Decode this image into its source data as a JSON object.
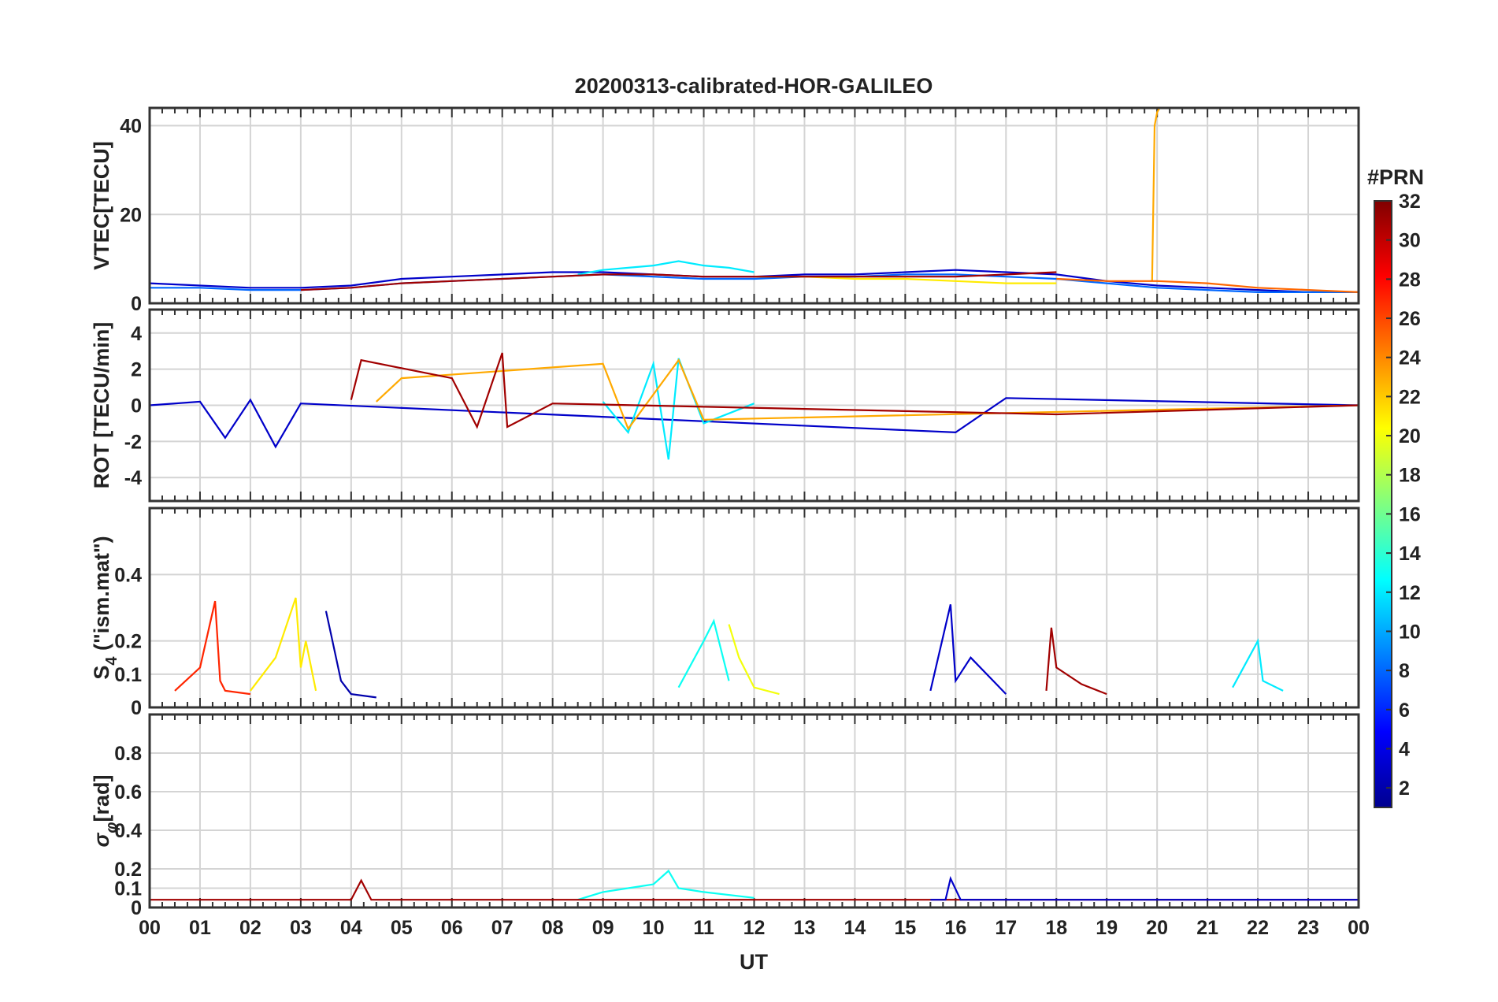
{
  "chart_data": {
    "type": "line",
    "title": "20200313-calibrated-HOR-GALILEO",
    "xlabel": "UT",
    "x_tick_labels": [
      "00",
      "01",
      "02",
      "03",
      "04",
      "05",
      "06",
      "07",
      "08",
      "09",
      "10",
      "11",
      "12",
      "13",
      "14",
      "15",
      "16",
      "17",
      "18",
      "19",
      "20",
      "21",
      "22",
      "23",
      "00"
    ],
    "xlim_hours": [
      0,
      24
    ],
    "grid": true,
    "panels": [
      {
        "id": "vtec",
        "ylabel_main": "VTEC[TECU]",
        "ylabel_sub": "",
        "ylabel_tail": "",
        "ylim": [
          0,
          44
        ],
        "yticks": [
          0,
          20,
          40
        ],
        "series": [
          {
            "prn": 3,
            "x": [
              0,
              1,
              2,
              3,
              4,
              5,
              6,
              7,
              8,
              9,
              10,
              11,
              12,
              13,
              14,
              15,
              16,
              17,
              18,
              19,
              20,
              21,
              22,
              23,
              24
            ],
            "y": [
              4.5,
              4,
              3.5,
              3.5,
              4,
              5.5,
              6,
              6.5,
              7,
              7,
              6.5,
              6,
              6,
              6.5,
              6.5,
              7,
              7.5,
              7,
              6.5,
              5,
              4,
              3.5,
              3,
              2.5,
              2.5
            ]
          },
          {
            "prn": 8,
            "x": [
              0,
              1,
              2,
              3,
              4,
              5,
              6,
              7,
              8,
              9,
              10,
              11,
              12,
              13,
              14,
              15,
              16,
              17,
              18,
              19,
              20,
              21,
              22,
              23,
              24
            ],
            "y": [
              3.5,
              3.5,
              3,
              3,
              3.5,
              4.5,
              5,
              5.5,
              6,
              6.5,
              6,
              5.5,
              5.5,
              6,
              6,
              6.5,
              6.5,
              6,
              5.5,
              4.5,
              3.5,
              3,
              2.5,
              2.5,
              2.5
            ]
          },
          {
            "prn": 12,
            "x": [
              8.5,
              9,
              9.5,
              10,
              10.5,
              11,
              11.5,
              12
            ],
            "y": [
              6.5,
              7.5,
              8,
              8.5,
              9.5,
              8.5,
              8,
              7
            ]
          },
          {
            "prn": 21,
            "x": [
              12,
              13,
              14,
              15,
              16,
              17,
              18
            ],
            "y": [
              6,
              6,
              5.5,
              5.5,
              5,
              4.5,
              4.5
            ]
          },
          {
            "prn": 23,
            "x": [
              19.9,
              19.95,
              20,
              20.05
            ],
            "y": [
              5,
              40,
              43,
              44
            ]
          },
          {
            "prn": 25,
            "x": [
              18,
              19,
              20,
              21,
              22,
              23,
              24
            ],
            "y": [
              5.5,
              5,
              5,
              4.5,
              3.5,
              3,
              2.5
            ]
          },
          {
            "prn": 31,
            "x": [
              3,
              4,
              5,
              6,
              7,
              8,
              9,
              10,
              11,
              12,
              13,
              14,
              15,
              16,
              17,
              18
            ],
            "y": [
              3,
              3.5,
              4.5,
              5,
              5.5,
              6,
              6.5,
              6.5,
              6,
              6,
              6,
              6,
              6,
              6,
              6.5,
              7
            ]
          }
        ]
      },
      {
        "id": "rot",
        "ylabel_main": "ROT [TECU/min]",
        "ylabel_sub": "",
        "ylabel_tail": "",
        "ylim": [
          -5.3,
          5.3
        ],
        "yticks": [
          -4,
          -2,
          0,
          2,
          4
        ],
        "series": [
          {
            "prn": 3,
            "x": [
              0,
              1,
              1.5,
              2,
              2.5,
              3,
              16,
              17,
              24
            ],
            "y": [
              0,
              0.2,
              -1.8,
              0.3,
              -2.3,
              0.1,
              -1.5,
              0.4,
              0
            ]
          },
          {
            "prn": 12,
            "x": [
              9,
              9.5,
              10,
              10.3,
              10.5,
              11,
              12
            ],
            "y": [
              0.2,
              -1.5,
              2.3,
              -3,
              2.6,
              -1,
              0.1
            ]
          },
          {
            "prn": 23,
            "x": [
              4.5,
              5,
              9,
              9.5,
              10.5,
              11,
              24
            ],
            "y": [
              0.2,
              1.5,
              2.3,
              -1.3,
              2.5,
              -0.8,
              0
            ]
          },
          {
            "prn": 31,
            "x": [
              4,
              4.2,
              6,
              6.5,
              7,
              7.1,
              8,
              18,
              24
            ],
            "y": [
              0.3,
              2.5,
              1.5,
              -1.2,
              2.9,
              -1.2,
              0.1,
              -0.5,
              0
            ]
          }
        ]
      },
      {
        "id": "s4",
        "ylabel_main": "S",
        "ylabel_sub": "4",
        "ylabel_tail": " (\"ism.mat\")",
        "ylim": [
          0,
          0.6
        ],
        "yticks": [
          0,
          0.1,
          0.2,
          0.4
        ],
        "series": [
          {
            "prn": 27,
            "x": [
              0.5,
              1,
              1.3,
              1.4,
              1.5,
              2
            ],
            "y": [
              0.05,
              0.12,
              0.32,
              0.08,
              0.05,
              0.04
            ]
          },
          {
            "prn": 21,
            "x": [
              2,
              2.5,
              2.9,
              3,
              3.1,
              3.3
            ],
            "y": [
              0.05,
              0.15,
              0.33,
              0.12,
              0.2,
              0.05
            ]
          },
          {
            "prn": 2,
            "x": [
              3.5,
              3.6,
              3.8,
              4,
              4.5
            ],
            "y": [
              0.29,
              0.22,
              0.08,
              0.04,
              0.03
            ]
          },
          {
            "prn": 13,
            "x": [
              10.5,
              11,
              11.2,
              11.5
            ],
            "y": [
              0.06,
              0.2,
              0.26,
              0.08
            ]
          },
          {
            "prn": 20,
            "x": [
              11.5,
              11.7,
              12,
              12.5
            ],
            "y": [
              0.25,
              0.15,
              0.06,
              0.04
            ]
          },
          {
            "prn": 3,
            "x": [
              15.5,
              15.9,
              16,
              16.3,
              17
            ],
            "y": [
              0.05,
              0.31,
              0.08,
              0.15,
              0.04
            ]
          },
          {
            "prn": 31,
            "x": [
              17.8,
              17.9,
              18,
              18.5,
              19
            ],
            "y": [
              0.05,
              0.24,
              0.12,
              0.07,
              0.04
            ]
          },
          {
            "prn": 12,
            "x": [
              21.5,
              22,
              22.1,
              22.5
            ],
            "y": [
              0.06,
              0.2,
              0.08,
              0.05
            ]
          }
        ]
      },
      {
        "id": "sigma",
        "ylabel_main": "σ",
        "ylabel_sub": "φ",
        "ylabel_tail": "[rad]",
        "ylim": [
          0,
          1.0
        ],
        "yticks": [
          0,
          0.1,
          0.2,
          0.4,
          0.6,
          0.8
        ],
        "series": [
          {
            "prn": 13,
            "x": [
              8.5,
              9,
              9.5,
              10,
              10.3,
              10.5,
              11,
              12
            ],
            "y": [
              0.04,
              0.08,
              0.1,
              0.12,
              0.19,
              0.1,
              0.08,
              0.05
            ]
          },
          {
            "prn": 31,
            "x": [
              0,
              4,
              4.2,
              4.4,
              24
            ],
            "y": [
              0.04,
              0.04,
              0.14,
              0.04,
              0.04
            ]
          },
          {
            "prn": 3,
            "x": [
              15.5,
              15.8,
              15.9,
              16.1,
              24
            ],
            "y": [
              0.04,
              0.04,
              0.15,
              0.04,
              0.04
            ]
          }
        ]
      }
    ],
    "colorbar": {
      "label": "#PRN",
      "tick_labels": [
        "2",
        "4",
        "6",
        "8",
        "10",
        "12",
        "14",
        "16",
        "18",
        "20",
        "22",
        "24",
        "26",
        "28",
        "30",
        "32"
      ],
      "range": [
        1,
        32
      ],
      "colormap": "jet",
      "colors": [
        "#00008f",
        "#0000ff",
        "#0080ff",
        "#00ffff",
        "#80ff80",
        "#ffff00",
        "#ff8000",
        "#ff0000",
        "#800000"
      ]
    }
  }
}
